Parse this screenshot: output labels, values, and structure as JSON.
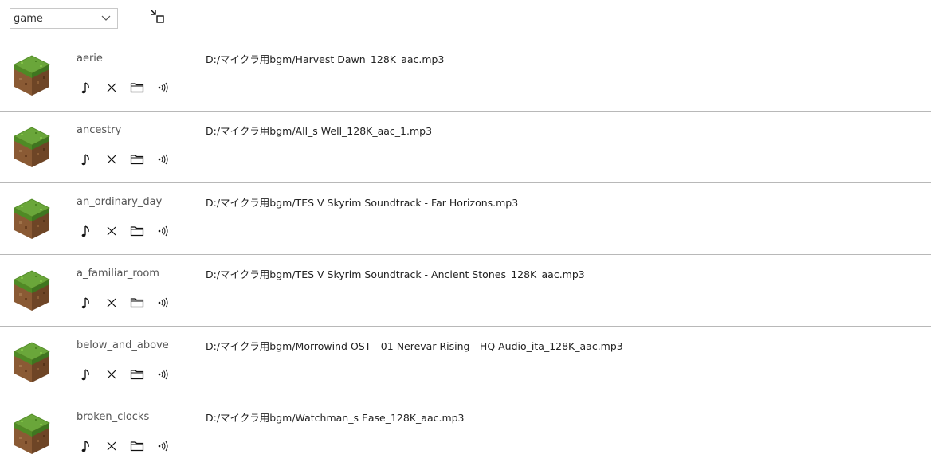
{
  "toolbar": {
    "category_select_value": "game"
  },
  "tracks": [
    {
      "name": "aerie",
      "path": "D:/マイクラ用bgm/Harvest Dawn_128K_aac.mp3"
    },
    {
      "name": "ancestry",
      "path": "D:/マイクラ用bgm/All_s Well_128K_aac_1.mp3"
    },
    {
      "name": "an_ordinary_day",
      "path": "D:/マイクラ用bgm/TES V Skyrim Soundtrack - Far Horizons.mp3"
    },
    {
      "name": "a_familiar_room",
      "path": "D:/マイクラ用bgm/TES V Skyrim Soundtrack - Ancient Stones_128K_aac.mp3"
    },
    {
      "name": "below_and_above",
      "path": "D:/マイクラ用bgm/Morrowind OST - 01 Nerevar Rising - HQ Audio_ita_128K_aac.mp3"
    },
    {
      "name": "broken_clocks",
      "path": "D:/マイクラ用bgm/Watchman_s Ease_128K_aac.mp3"
    }
  ],
  "icons": {
    "block": "grass-block-icon",
    "play": "music-note-icon",
    "remove": "close-icon",
    "folder": "folder-icon",
    "sound": "speaker-icon",
    "expand": "expand-arrow-icon",
    "dropdown": "chevron-down-icon"
  },
  "colors": {
    "grass_top": "#5f9b2f",
    "dirt": "#8a5a34",
    "divider": "#b8b8b8"
  }
}
